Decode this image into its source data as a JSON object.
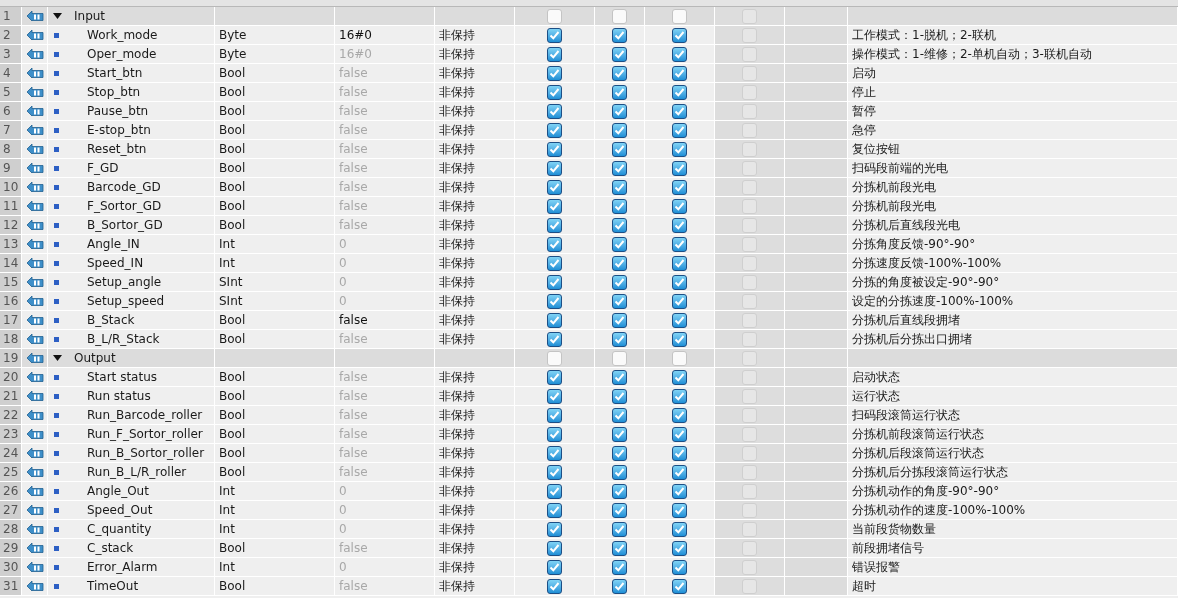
{
  "rows": [
    {
      "num": "1",
      "kind": "section",
      "name": "Input",
      "expanded": true,
      "hmi_access": false,
      "hmi_visible": false,
      "hmi_writable": false,
      "setpoint": false
    },
    {
      "num": "2",
      "kind": "member",
      "name": "Work_mode",
      "type": "Byte",
      "default": "16#0",
      "explicit": true,
      "retain": "非保持",
      "hmi_access": true,
      "hmi_visible": true,
      "hmi_writable": true,
      "setpoint": false,
      "comment": "工作模式：1-脱机；2-联机"
    },
    {
      "num": "3",
      "kind": "member",
      "name": "Oper_mode",
      "type": "Byte",
      "default": "16#0",
      "explicit": false,
      "retain": "非保持",
      "hmi_access": true,
      "hmi_visible": true,
      "hmi_writable": true,
      "setpoint": false,
      "comment": "操作模式：1-维修；2-单机自动；3-联机自动"
    },
    {
      "num": "4",
      "kind": "member",
      "name": "Start_btn",
      "type": "Bool",
      "default": "false",
      "explicit": false,
      "retain": "非保持",
      "hmi_access": true,
      "hmi_visible": true,
      "hmi_writable": true,
      "setpoint": false,
      "comment": "启动"
    },
    {
      "num": "5",
      "kind": "member",
      "name": "Stop_btn",
      "type": "Bool",
      "default": "false",
      "explicit": false,
      "retain": "非保持",
      "hmi_access": true,
      "hmi_visible": true,
      "hmi_writable": true,
      "setpoint": false,
      "comment": "停止"
    },
    {
      "num": "6",
      "kind": "member",
      "name": "Pause_btn",
      "type": "Bool",
      "default": "false",
      "explicit": false,
      "retain": "非保持",
      "hmi_access": true,
      "hmi_visible": true,
      "hmi_writable": true,
      "setpoint": false,
      "comment": "暂停"
    },
    {
      "num": "7",
      "kind": "member",
      "name": "E-stop_btn",
      "type": "Bool",
      "default": "false",
      "explicit": false,
      "retain": "非保持",
      "hmi_access": true,
      "hmi_visible": true,
      "hmi_writable": true,
      "setpoint": false,
      "comment": "急停"
    },
    {
      "num": "8",
      "kind": "member",
      "name": "Reset_btn",
      "type": "Bool",
      "default": "false",
      "explicit": false,
      "retain": "非保持",
      "hmi_access": true,
      "hmi_visible": true,
      "hmi_writable": true,
      "setpoint": false,
      "comment": "复位按钮"
    },
    {
      "num": "9",
      "kind": "member",
      "name": "F_GD",
      "type": "Bool",
      "default": "false",
      "explicit": false,
      "retain": "非保持",
      "hmi_access": true,
      "hmi_visible": true,
      "hmi_writable": true,
      "setpoint": false,
      "comment": "扫码段前端的光电"
    },
    {
      "num": "10",
      "kind": "member",
      "name": "Barcode_GD",
      "type": "Bool",
      "default": "false",
      "explicit": false,
      "retain": "非保持",
      "hmi_access": true,
      "hmi_visible": true,
      "hmi_writable": true,
      "setpoint": false,
      "comment": "分拣机前段光电"
    },
    {
      "num": "11",
      "kind": "member",
      "name": "F_Sortor_GD",
      "type": "Bool",
      "default": "false",
      "explicit": false,
      "retain": "非保持",
      "hmi_access": true,
      "hmi_visible": true,
      "hmi_writable": true,
      "setpoint": false,
      "comment": "分拣机前段光电"
    },
    {
      "num": "12",
      "kind": "member",
      "name": "B_Sortor_GD",
      "type": "Bool",
      "default": "false",
      "explicit": false,
      "retain": "非保持",
      "hmi_access": true,
      "hmi_visible": true,
      "hmi_writable": true,
      "setpoint": false,
      "comment": "分拣机后直线段光电"
    },
    {
      "num": "13",
      "kind": "member",
      "name": "Angle_IN",
      "type": "Int",
      "default": "0",
      "explicit": false,
      "retain": "非保持",
      "hmi_access": true,
      "hmi_visible": true,
      "hmi_writable": true,
      "setpoint": false,
      "comment": "分拣角度反馈-90°-90°"
    },
    {
      "num": "14",
      "kind": "member",
      "name": "Speed_IN",
      "type": "Int",
      "default": "0",
      "explicit": false,
      "retain": "非保持",
      "hmi_access": true,
      "hmi_visible": true,
      "hmi_writable": true,
      "setpoint": false,
      "comment": "分拣速度反馈-100%-100%"
    },
    {
      "num": "15",
      "kind": "member",
      "name": "Setup_angle",
      "type": "SInt",
      "default": "0",
      "explicit": false,
      "retain": "非保持",
      "hmi_access": true,
      "hmi_visible": true,
      "hmi_writable": true,
      "setpoint": false,
      "comment": "分拣的角度被设定-90°-90°"
    },
    {
      "num": "16",
      "kind": "member",
      "name": "Setup_speed",
      "type": "SInt",
      "default": "0",
      "explicit": false,
      "retain": "非保持",
      "hmi_access": true,
      "hmi_visible": true,
      "hmi_writable": true,
      "setpoint": false,
      "comment": "设定的分拣速度-100%-100%"
    },
    {
      "num": "17",
      "kind": "member",
      "name": "B_Stack",
      "type": "Bool",
      "default": "false",
      "explicit": true,
      "retain": "非保持",
      "hmi_access": true,
      "hmi_visible": true,
      "hmi_writable": true,
      "setpoint": false,
      "comment": "分拣机后直线段拥堵"
    },
    {
      "num": "18",
      "kind": "member",
      "name": "B_L/R_Stack",
      "type": "Bool",
      "default": "false",
      "explicit": false,
      "retain": "非保持",
      "hmi_access": true,
      "hmi_visible": true,
      "hmi_writable": true,
      "setpoint": false,
      "comment": "分拣机后分拣出口拥堵"
    },
    {
      "num": "19",
      "kind": "section",
      "name": "Output",
      "expanded": true,
      "hmi_access": false,
      "hmi_visible": false,
      "hmi_writable": false,
      "setpoint": false
    },
    {
      "num": "20",
      "kind": "member",
      "name": "Start status",
      "type": "Bool",
      "default": "false",
      "explicit": false,
      "retain": "非保持",
      "hmi_access": true,
      "hmi_visible": true,
      "hmi_writable": true,
      "setpoint": false,
      "comment": "启动状态"
    },
    {
      "num": "21",
      "kind": "member",
      "name": "Run status",
      "type": "Bool",
      "default": "false",
      "explicit": false,
      "retain": "非保持",
      "hmi_access": true,
      "hmi_visible": true,
      "hmi_writable": true,
      "setpoint": false,
      "comment": "运行状态"
    },
    {
      "num": "22",
      "kind": "member",
      "name": "Run_Barcode_roller",
      "type": "Bool",
      "default": "false",
      "explicit": false,
      "retain": "非保持",
      "hmi_access": true,
      "hmi_visible": true,
      "hmi_writable": true,
      "setpoint": false,
      "comment": "扫码段滚筒运行状态"
    },
    {
      "num": "23",
      "kind": "member",
      "name": "Run_F_Sortor_roller",
      "type": "Bool",
      "default": "false",
      "explicit": false,
      "retain": "非保持",
      "hmi_access": true,
      "hmi_visible": true,
      "hmi_writable": true,
      "setpoint": false,
      "comment": "分拣机前段滚筒运行状态"
    },
    {
      "num": "24",
      "kind": "member",
      "name": "Run_B_Sortor_roller",
      "type": "Bool",
      "default": "false",
      "explicit": false,
      "retain": "非保持",
      "hmi_access": true,
      "hmi_visible": true,
      "hmi_writable": true,
      "setpoint": false,
      "comment": "分拣机后段滚筒运行状态"
    },
    {
      "num": "25",
      "kind": "member",
      "name": "Run_B_L/R_roller",
      "type": "Bool",
      "default": "false",
      "explicit": false,
      "retain": "非保持",
      "hmi_access": true,
      "hmi_visible": true,
      "hmi_writable": true,
      "setpoint": false,
      "comment": "分拣机后分拣段滚筒运行状态"
    },
    {
      "num": "26",
      "kind": "member",
      "name": "Angle_Out",
      "type": "Int",
      "default": "0",
      "explicit": false,
      "retain": "非保持",
      "hmi_access": true,
      "hmi_visible": true,
      "hmi_writable": true,
      "setpoint": false,
      "comment": "分拣机动作的角度-90°-90°"
    },
    {
      "num": "27",
      "kind": "member",
      "name": "Speed_Out",
      "type": "Int",
      "default": "0",
      "explicit": false,
      "retain": "非保持",
      "hmi_access": true,
      "hmi_visible": true,
      "hmi_writable": true,
      "setpoint": false,
      "comment": "分拣机动作的速度-100%-100%"
    },
    {
      "num": "28",
      "kind": "member",
      "name": "C_quantity",
      "type": "Int",
      "default": "0",
      "explicit": false,
      "retain": "非保持",
      "hmi_access": true,
      "hmi_visible": true,
      "hmi_writable": true,
      "setpoint": false,
      "comment": "当前段货物数量"
    },
    {
      "num": "29",
      "kind": "member",
      "name": "C_stack",
      "type": "Bool",
      "default": "false",
      "explicit": false,
      "retain": "非保持",
      "hmi_access": true,
      "hmi_visible": true,
      "hmi_writable": true,
      "setpoint": false,
      "comment": "前段拥堵信号"
    },
    {
      "num": "30",
      "kind": "member",
      "name": "Error_Alarm",
      "type": "Int",
      "default": "0",
      "explicit": false,
      "retain": "非保持",
      "hmi_access": true,
      "hmi_visible": true,
      "hmi_writable": true,
      "setpoint": false,
      "comment": "错误报警"
    },
    {
      "num": "31",
      "kind": "member",
      "name": "TimeOut",
      "type": "Bool",
      "default": "false",
      "explicit": false,
      "retain": "非保持",
      "hmi_access": true,
      "hmi_visible": true,
      "hmi_writable": true,
      "setpoint": false,
      "comment": "超时"
    }
  ]
}
